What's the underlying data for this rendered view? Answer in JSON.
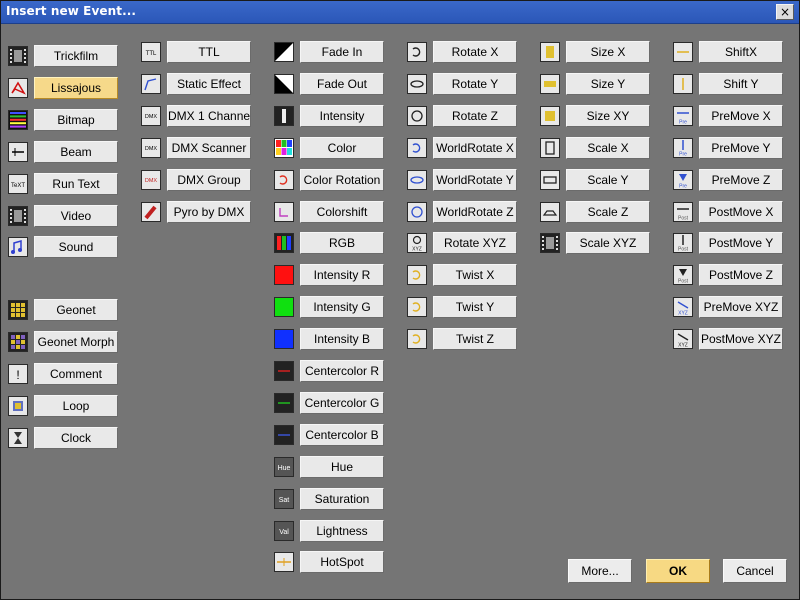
{
  "window": {
    "title": "Insert new Event...",
    "close_glyph": "×"
  },
  "columns": [
    {
      "items": [
        {
          "label": "Trickfilm",
          "icon": "film-icon",
          "active": false
        },
        {
          "label": "Lissajous",
          "icon": "lissajous-icon",
          "active": true
        },
        {
          "label": "Bitmap",
          "icon": "bitmap-icon",
          "active": false
        },
        {
          "label": "Beam",
          "icon": "beam-icon",
          "active": false
        },
        {
          "label": "Run Text",
          "icon": "text-icon",
          "active": false
        },
        {
          "label": "Video",
          "icon": "video-icon",
          "active": false
        },
        {
          "label": "Sound",
          "icon": "sound-icon",
          "active": false
        }
      ]
    },
    {
      "items": [
        {
          "label": "Geonet",
          "icon": "geonet-icon",
          "active": false
        },
        {
          "label": "Geonet Morph",
          "icon": "geonet-morph-icon",
          "active": false
        },
        {
          "label": "Comment",
          "icon": "comment-icon",
          "active": false
        },
        {
          "label": "Loop",
          "icon": "loop-icon",
          "active": false
        },
        {
          "label": "Clock",
          "icon": "hourglass-icon",
          "active": false
        }
      ]
    },
    {
      "items": [
        {
          "label": "TTL",
          "icon": "ttl-icon",
          "active": false
        },
        {
          "label": "Static Effect",
          "icon": "static-effect-icon",
          "active": false
        },
        {
          "label": "DMX 1 Channel",
          "icon": "dmx-icon",
          "active": false
        },
        {
          "label": "DMX Scanner",
          "icon": "dmx-scanner-icon",
          "active": false
        },
        {
          "label": "DMX Group",
          "icon": "dmx-group-icon",
          "active": false
        },
        {
          "label": "Pyro by DMX",
          "icon": "pyro-icon",
          "active": false
        }
      ]
    },
    {
      "items": [
        {
          "label": "Fade In",
          "icon": "fade-in-icon",
          "active": false
        },
        {
          "label": "Fade Out",
          "icon": "fade-out-icon",
          "active": false
        },
        {
          "label": "Intensity",
          "icon": "intensity-icon",
          "active": false
        },
        {
          "label": "Color",
          "icon": "color-icon",
          "active": false
        },
        {
          "label": "Color Rotation",
          "icon": "color-rotation-icon",
          "active": false
        },
        {
          "label": "Colorshift",
          "icon": "colorshift-icon",
          "active": false
        },
        {
          "label": "RGB",
          "icon": "rgb-icon",
          "active": false
        },
        {
          "label": "Intensity R",
          "icon": "intensity-r-icon",
          "active": false
        },
        {
          "label": "Intensity G",
          "icon": "intensity-g-icon",
          "active": false
        },
        {
          "label": "Intensity B",
          "icon": "intensity-b-icon",
          "active": false
        },
        {
          "label": "Centercolor R",
          "icon": "centercolor-r-icon",
          "active": false
        },
        {
          "label": "Centercolor G",
          "icon": "centercolor-g-icon",
          "active": false
        },
        {
          "label": "Centercolor B",
          "icon": "centercolor-b-icon",
          "active": false
        },
        {
          "label": "Hue",
          "icon": "hue-icon",
          "icon_text": "Hue",
          "active": false
        },
        {
          "label": "Saturation",
          "icon": "saturation-icon",
          "icon_text": "Sat",
          "active": false
        },
        {
          "label": "Lightness",
          "icon": "lightness-icon",
          "icon_text": "Val",
          "active": false
        },
        {
          "label": "HotSpot",
          "icon": "hotspot-icon",
          "active": false
        }
      ]
    },
    {
      "items": [
        {
          "label": "Rotate X",
          "icon": "rotate-x-icon",
          "active": false
        },
        {
          "label": "Rotate Y",
          "icon": "rotate-y-icon",
          "active": false
        },
        {
          "label": "Rotate Z",
          "icon": "rotate-z-icon",
          "active": false
        },
        {
          "label": "WorldRotate X",
          "icon": "worldrotate-x-icon",
          "active": false
        },
        {
          "label": "WorldRotate Y",
          "icon": "worldrotate-y-icon",
          "active": false
        },
        {
          "label": "WorldRotate Z",
          "icon": "worldrotate-z-icon",
          "active": false
        },
        {
          "label": "Rotate XYZ",
          "icon": "rotate-xyz-icon",
          "icon_text": "XYZ",
          "active": false
        },
        {
          "label": "Twist X",
          "icon": "twist-x-icon",
          "active": false
        },
        {
          "label": "Twist Y",
          "icon": "twist-y-icon",
          "active": false
        },
        {
          "label": "Twist Z",
          "icon": "twist-z-icon",
          "active": false
        }
      ]
    },
    {
      "items": [
        {
          "label": "Size X",
          "icon": "size-x-icon",
          "active": false
        },
        {
          "label": "Size Y",
          "icon": "size-y-icon",
          "active": false
        },
        {
          "label": "Size XY",
          "icon": "size-xy-icon",
          "active": false
        },
        {
          "label": "Scale X",
          "icon": "scale-x-icon",
          "active": false
        },
        {
          "label": "Scale Y",
          "icon": "scale-y-icon",
          "active": false
        },
        {
          "label": "Scale Z",
          "icon": "scale-z-icon",
          "active": false
        },
        {
          "label": "Scale XYZ",
          "icon": "scale-xyz-icon",
          "active": false
        }
      ]
    },
    {
      "items": [
        {
          "label": "ShiftX",
          "icon": "shift-x-icon",
          "active": false
        },
        {
          "label": "Shift Y",
          "icon": "shift-y-icon",
          "active": false
        },
        {
          "label": "PreMove X",
          "icon": "premove-x-icon",
          "icon_text": "Pre",
          "active": false
        },
        {
          "label": "PreMove Y",
          "icon": "premove-y-icon",
          "icon_text": "Pre",
          "active": false
        },
        {
          "label": "PreMove Z",
          "icon": "premove-z-icon",
          "icon_text": "Pre",
          "active": false
        },
        {
          "label": "PostMove X",
          "icon": "postmove-x-icon",
          "icon_text": "Post",
          "active": false
        },
        {
          "label": "PostMove Y",
          "icon": "postmove-y-icon",
          "icon_text": "Post",
          "active": false
        },
        {
          "label": "PostMove Z",
          "icon": "postmove-z-icon",
          "icon_text": "Post",
          "active": false
        },
        {
          "label": "PreMove XYZ",
          "icon": "premove-xyz-icon",
          "icon_text": "XYZ",
          "active": false
        },
        {
          "label": "PostMove XYZ",
          "icon": "postmove-xyz-icon",
          "icon_text": "XYZ",
          "active": false
        }
      ]
    }
  ],
  "footer": {
    "more_label": "More...",
    "ok_label": "OK",
    "cancel_label": "Cancel"
  },
  "colors": {
    "window_bg": "#757575",
    "titlebar": "#3162c2",
    "active_button": "#f6d98a",
    "button": "#e9e9e9"
  }
}
